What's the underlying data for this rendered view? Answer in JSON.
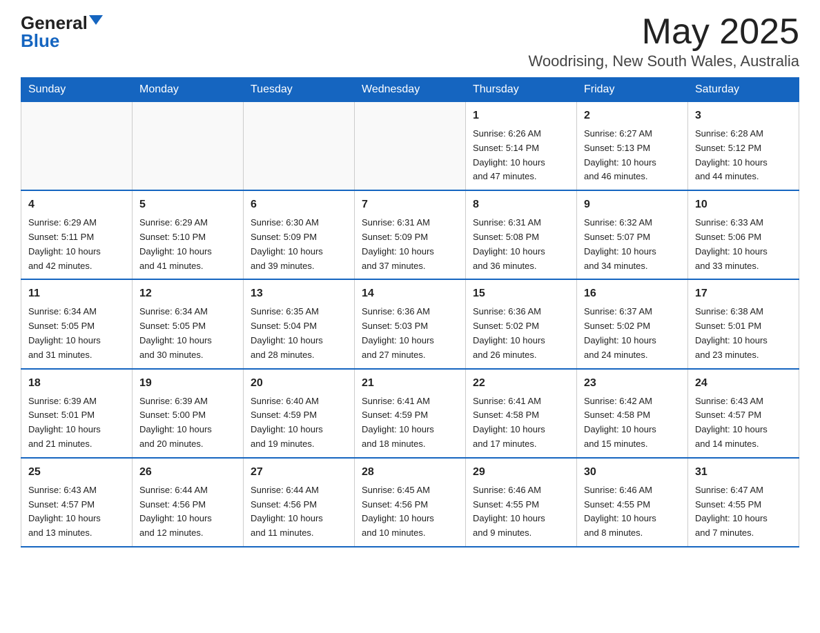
{
  "logo": {
    "general": "General",
    "blue": "Blue"
  },
  "header": {
    "month": "May 2025",
    "location": "Woodrising, New South Wales, Australia"
  },
  "days_of_week": [
    "Sunday",
    "Monday",
    "Tuesday",
    "Wednesday",
    "Thursday",
    "Friday",
    "Saturday"
  ],
  "weeks": [
    [
      {
        "day": "",
        "info": ""
      },
      {
        "day": "",
        "info": ""
      },
      {
        "day": "",
        "info": ""
      },
      {
        "day": "",
        "info": ""
      },
      {
        "day": "1",
        "info": "Sunrise: 6:26 AM\nSunset: 5:14 PM\nDaylight: 10 hours\nand 47 minutes."
      },
      {
        "day": "2",
        "info": "Sunrise: 6:27 AM\nSunset: 5:13 PM\nDaylight: 10 hours\nand 46 minutes."
      },
      {
        "day": "3",
        "info": "Sunrise: 6:28 AM\nSunset: 5:12 PM\nDaylight: 10 hours\nand 44 minutes."
      }
    ],
    [
      {
        "day": "4",
        "info": "Sunrise: 6:29 AM\nSunset: 5:11 PM\nDaylight: 10 hours\nand 42 minutes."
      },
      {
        "day": "5",
        "info": "Sunrise: 6:29 AM\nSunset: 5:10 PM\nDaylight: 10 hours\nand 41 minutes."
      },
      {
        "day": "6",
        "info": "Sunrise: 6:30 AM\nSunset: 5:09 PM\nDaylight: 10 hours\nand 39 minutes."
      },
      {
        "day": "7",
        "info": "Sunrise: 6:31 AM\nSunset: 5:09 PM\nDaylight: 10 hours\nand 37 minutes."
      },
      {
        "day": "8",
        "info": "Sunrise: 6:31 AM\nSunset: 5:08 PM\nDaylight: 10 hours\nand 36 minutes."
      },
      {
        "day": "9",
        "info": "Sunrise: 6:32 AM\nSunset: 5:07 PM\nDaylight: 10 hours\nand 34 minutes."
      },
      {
        "day": "10",
        "info": "Sunrise: 6:33 AM\nSunset: 5:06 PM\nDaylight: 10 hours\nand 33 minutes."
      }
    ],
    [
      {
        "day": "11",
        "info": "Sunrise: 6:34 AM\nSunset: 5:05 PM\nDaylight: 10 hours\nand 31 minutes."
      },
      {
        "day": "12",
        "info": "Sunrise: 6:34 AM\nSunset: 5:05 PM\nDaylight: 10 hours\nand 30 minutes."
      },
      {
        "day": "13",
        "info": "Sunrise: 6:35 AM\nSunset: 5:04 PM\nDaylight: 10 hours\nand 28 minutes."
      },
      {
        "day": "14",
        "info": "Sunrise: 6:36 AM\nSunset: 5:03 PM\nDaylight: 10 hours\nand 27 minutes."
      },
      {
        "day": "15",
        "info": "Sunrise: 6:36 AM\nSunset: 5:02 PM\nDaylight: 10 hours\nand 26 minutes."
      },
      {
        "day": "16",
        "info": "Sunrise: 6:37 AM\nSunset: 5:02 PM\nDaylight: 10 hours\nand 24 minutes."
      },
      {
        "day": "17",
        "info": "Sunrise: 6:38 AM\nSunset: 5:01 PM\nDaylight: 10 hours\nand 23 minutes."
      }
    ],
    [
      {
        "day": "18",
        "info": "Sunrise: 6:39 AM\nSunset: 5:01 PM\nDaylight: 10 hours\nand 21 minutes."
      },
      {
        "day": "19",
        "info": "Sunrise: 6:39 AM\nSunset: 5:00 PM\nDaylight: 10 hours\nand 20 minutes."
      },
      {
        "day": "20",
        "info": "Sunrise: 6:40 AM\nSunset: 4:59 PM\nDaylight: 10 hours\nand 19 minutes."
      },
      {
        "day": "21",
        "info": "Sunrise: 6:41 AM\nSunset: 4:59 PM\nDaylight: 10 hours\nand 18 minutes."
      },
      {
        "day": "22",
        "info": "Sunrise: 6:41 AM\nSunset: 4:58 PM\nDaylight: 10 hours\nand 17 minutes."
      },
      {
        "day": "23",
        "info": "Sunrise: 6:42 AM\nSunset: 4:58 PM\nDaylight: 10 hours\nand 15 minutes."
      },
      {
        "day": "24",
        "info": "Sunrise: 6:43 AM\nSunset: 4:57 PM\nDaylight: 10 hours\nand 14 minutes."
      }
    ],
    [
      {
        "day": "25",
        "info": "Sunrise: 6:43 AM\nSunset: 4:57 PM\nDaylight: 10 hours\nand 13 minutes."
      },
      {
        "day": "26",
        "info": "Sunrise: 6:44 AM\nSunset: 4:56 PM\nDaylight: 10 hours\nand 12 minutes."
      },
      {
        "day": "27",
        "info": "Sunrise: 6:44 AM\nSunset: 4:56 PM\nDaylight: 10 hours\nand 11 minutes."
      },
      {
        "day": "28",
        "info": "Sunrise: 6:45 AM\nSunset: 4:56 PM\nDaylight: 10 hours\nand 10 minutes."
      },
      {
        "day": "29",
        "info": "Sunrise: 6:46 AM\nSunset: 4:55 PM\nDaylight: 10 hours\nand 9 minutes."
      },
      {
        "day": "30",
        "info": "Sunrise: 6:46 AM\nSunset: 4:55 PM\nDaylight: 10 hours\nand 8 minutes."
      },
      {
        "day": "31",
        "info": "Sunrise: 6:47 AM\nSunset: 4:55 PM\nDaylight: 10 hours\nand 7 minutes."
      }
    ]
  ]
}
